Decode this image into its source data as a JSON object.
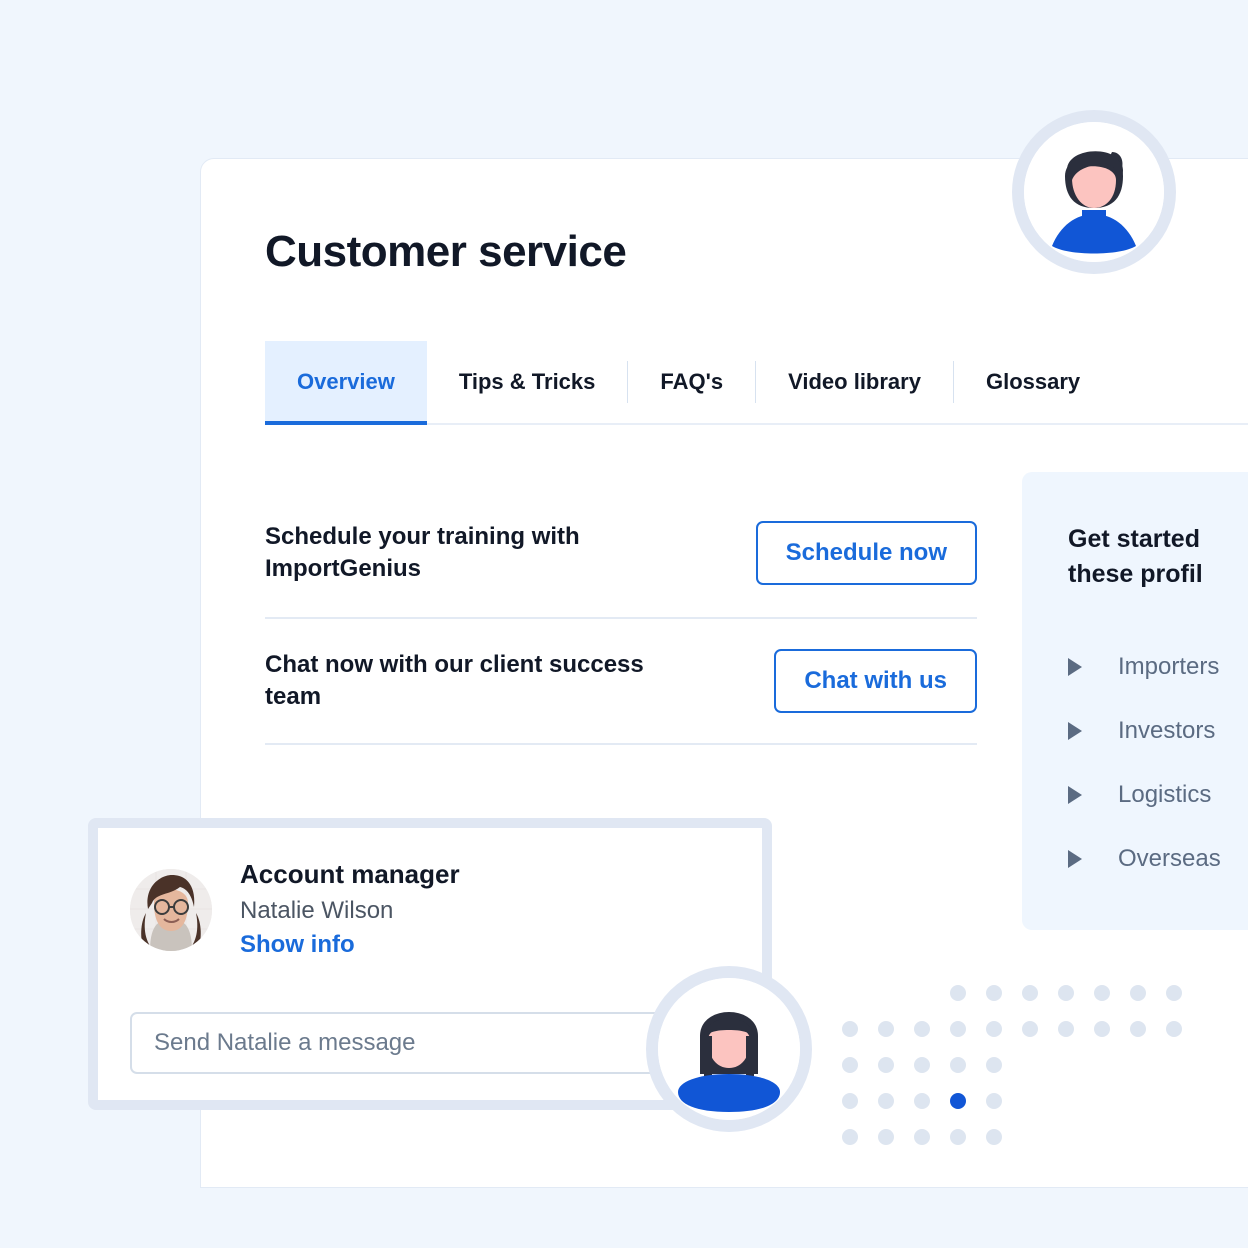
{
  "page": {
    "background_color": "#f0f6fd",
    "accent_color": "#1a6bdb",
    "title": "Customer service"
  },
  "tabs": [
    {
      "label": "Overview",
      "active": true
    },
    {
      "label": "Tips & Tricks",
      "active": false
    },
    {
      "label": "FAQ's",
      "active": false
    },
    {
      "label": "Video library",
      "active": false
    },
    {
      "label": "Glossary",
      "active": false
    }
  ],
  "action_rows": [
    {
      "label": "Schedule your training with ImportGenius",
      "button": "Schedule now"
    },
    {
      "label": "Chat now with our client success team",
      "button": "Chat with us"
    }
  ],
  "side_panel": {
    "title": "Get started\nthese profil",
    "items": [
      "Importers",
      "Investors",
      "Logistics",
      "Overseas"
    ]
  },
  "message_card": {
    "role": "Account manager",
    "name": "Natalie Wilson",
    "link": "Show info",
    "input_placeholder": "Send Natalie a message",
    "input_value": ""
  },
  "avatars": [
    {
      "name": "user-avatar-top",
      "type": "male-illustration",
      "hair": "#2b2f3d",
      "skin": "#fcc4c0",
      "shirt": "#1156d6"
    },
    {
      "name": "user-avatar-bottom",
      "type": "female-illustration",
      "hair": "#2b2f3d",
      "skin": "#fcc4c0",
      "shirt": "#1156d6"
    }
  ],
  "dot_grid": {
    "rows": 5,
    "cols": 11,
    "dot_color": "#dde5f0",
    "accent_dot_color": "#1156d6",
    "accent_index": {
      "row": 3,
      "col": 3
    }
  }
}
